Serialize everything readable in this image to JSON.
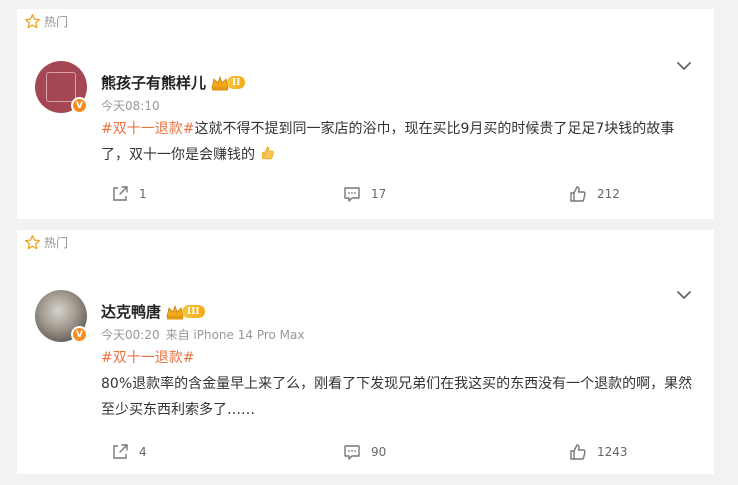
{
  "posts": [
    {
      "hot_label": "热门",
      "username": "熊孩子有熊样儿",
      "vip_level": "II",
      "verified_mark": "V",
      "time": "今天08:10",
      "source": "",
      "tag": "#双十一退款#",
      "body": "这就不得不提到同一家店的浴巾，现在买比9月买的时候贵了足足7块钱的故事了，双十一你是会赚钱的",
      "reposts": "1",
      "comments": "17",
      "likes": "212"
    },
    {
      "hot_label": "热门",
      "username": "达克鸭唐",
      "vip_level": "III",
      "verified_mark": "V",
      "time": "今天00:20",
      "source": "来自 iPhone 14 Pro Max",
      "tag": "#双十一退款#",
      "body": "80%退款率的含金量早上来了么，刚看了下发现兄弟们在我这买的东西没有一个退款的啊，果然至少买东西利索多了……",
      "reposts": "4",
      "comments": "90",
      "likes": "1243"
    }
  ],
  "colors": {
    "tag": "#eb7340",
    "vip_gold": "#f3a81a",
    "verified_orange": "#f78c1f",
    "muted": "#999999"
  },
  "icons": [
    "star-icon",
    "chevron-down-icon",
    "repost-icon",
    "comment-icon",
    "like-icon",
    "thumbs-up-emoji"
  ]
}
